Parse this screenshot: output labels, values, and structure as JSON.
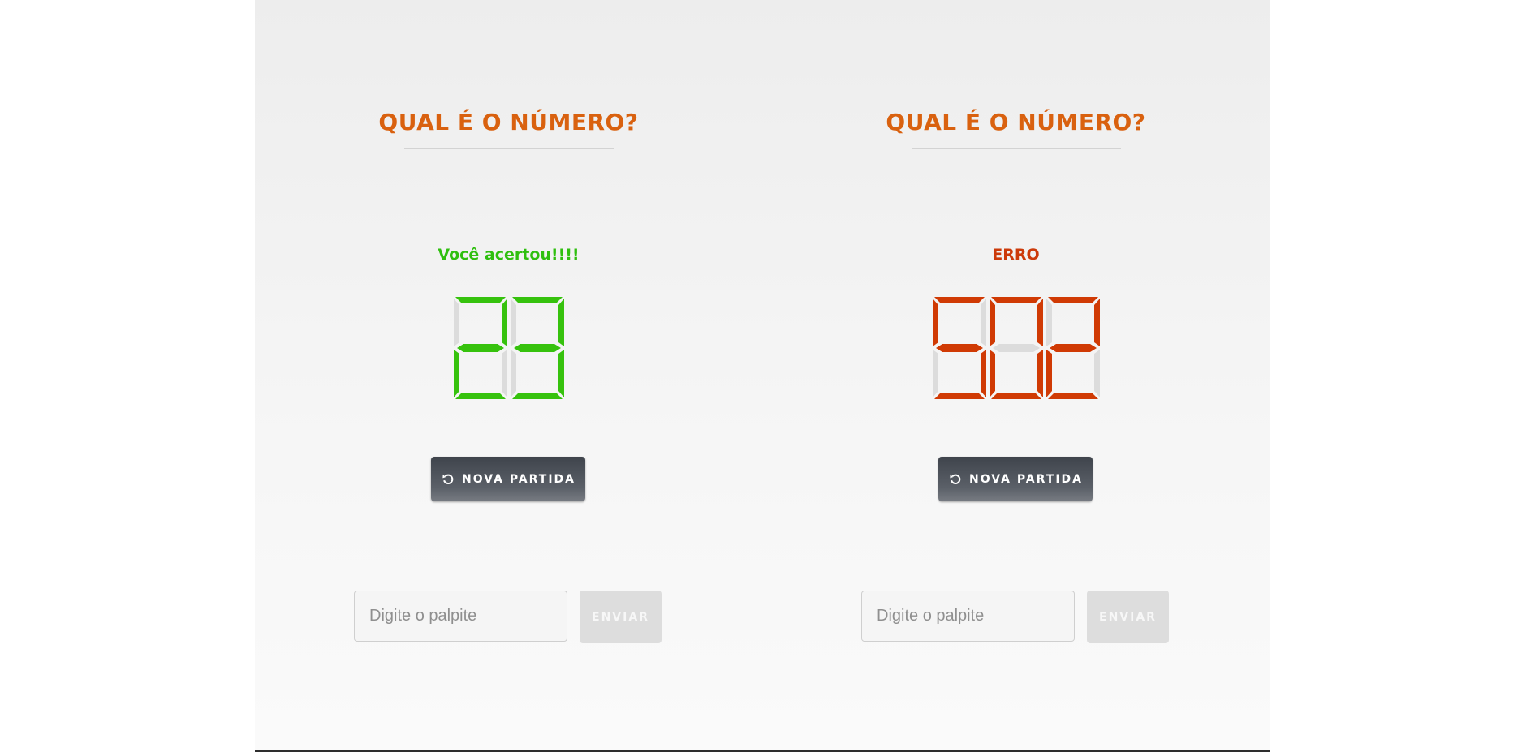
{
  "games": [
    {
      "title": "QUAL É O NÚMERO?",
      "status": "Você acertou!!!!",
      "status_color": "#2fbf0f",
      "led_digits": [
        "2",
        "3"
      ],
      "led_color": "#36c20d",
      "new_game_label": "NOVA PARTIDA",
      "new_game_icon": "restart-icon",
      "guess_placeholder": "Digite o palpite",
      "send_label": "ENVIAR"
    },
    {
      "title": "QUAL É O NÚMERO?",
      "status": "ERRO",
      "status_color": "#cc3a0a",
      "led_digits": [
        "5",
        "0",
        "2"
      ],
      "led_color": "#d03a04",
      "new_game_label": "NOVA PARTIDA",
      "new_game_icon": "restart-icon",
      "guess_placeholder": "Digite o palpite",
      "send_label": "ENVIAR"
    }
  ],
  "colors": {
    "title": "#d9610f",
    "segment_off": "#dcdcdc",
    "button_dark": "#4a4f57",
    "send_disabled": "#dddddd"
  }
}
